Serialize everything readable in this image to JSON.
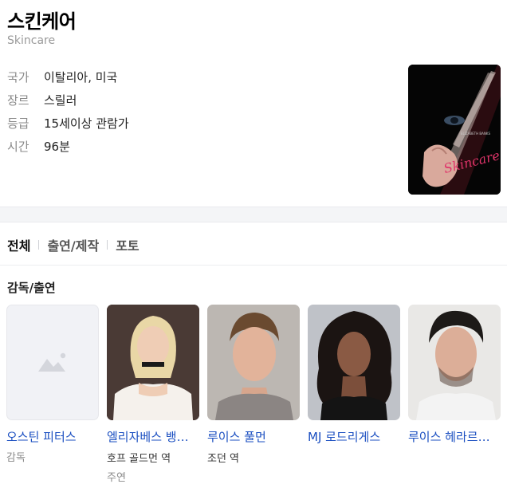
{
  "header": {
    "title": "스킨케어",
    "subtitle": "Skincare",
    "info": [
      {
        "key": "국가",
        "value": "이탈리아, 미국"
      },
      {
        "key": "장르",
        "value": "스릴러"
      },
      {
        "key": "등급",
        "value": "15세이상 관람가"
      },
      {
        "key": "시간",
        "value": "96분"
      }
    ],
    "poster": {
      "credit": "ELIZABETH BANKS",
      "script": "Skincare"
    }
  },
  "tabs": [
    "전체",
    "출연/제작",
    "포토"
  ],
  "section": {
    "title": "감독/출연"
  },
  "cast": [
    {
      "name": "오스틴 피터스",
      "role": "감독",
      "role2": ""
    },
    {
      "name": "엘리자베스 뱅…",
      "role": "호프 골드먼 역",
      "role2": "주연"
    },
    {
      "name": "루이스 풀먼",
      "role": "조던 역",
      "role2": ""
    },
    {
      "name": "MJ 로드리게스",
      "role": "",
      "role2": ""
    },
    {
      "name": "루이스 헤라르…",
      "role": "",
      "role2": ""
    }
  ],
  "colors": {
    "link": "#1b4fc1",
    "muted": "#8a8a8a",
    "separator": "#f4f5f7"
  }
}
